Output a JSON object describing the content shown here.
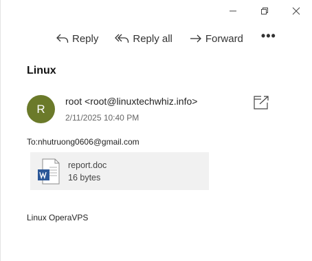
{
  "window": {
    "controls": {
      "minimize_icon": "minimize-icon",
      "restore_icon": "restore-icon",
      "close_icon": "close-icon"
    }
  },
  "toolbar": {
    "reply_label": "Reply",
    "reply_all_label": "Reply all",
    "forward_label": "Forward",
    "more_label": "•••"
  },
  "message": {
    "subject": "Linux",
    "avatar_initial": "R",
    "avatar_color": "#6b7a2a",
    "sender": "root <root@linuxtechwhiz.info>",
    "datetime": "2/11/2025 10:40 PM",
    "to": "To:nhutruong0606@gmail.com",
    "attachment": {
      "name": "report.doc",
      "size": "16 bytes",
      "icon": "word-document-icon"
    },
    "body": "Linux OperaVPS"
  }
}
